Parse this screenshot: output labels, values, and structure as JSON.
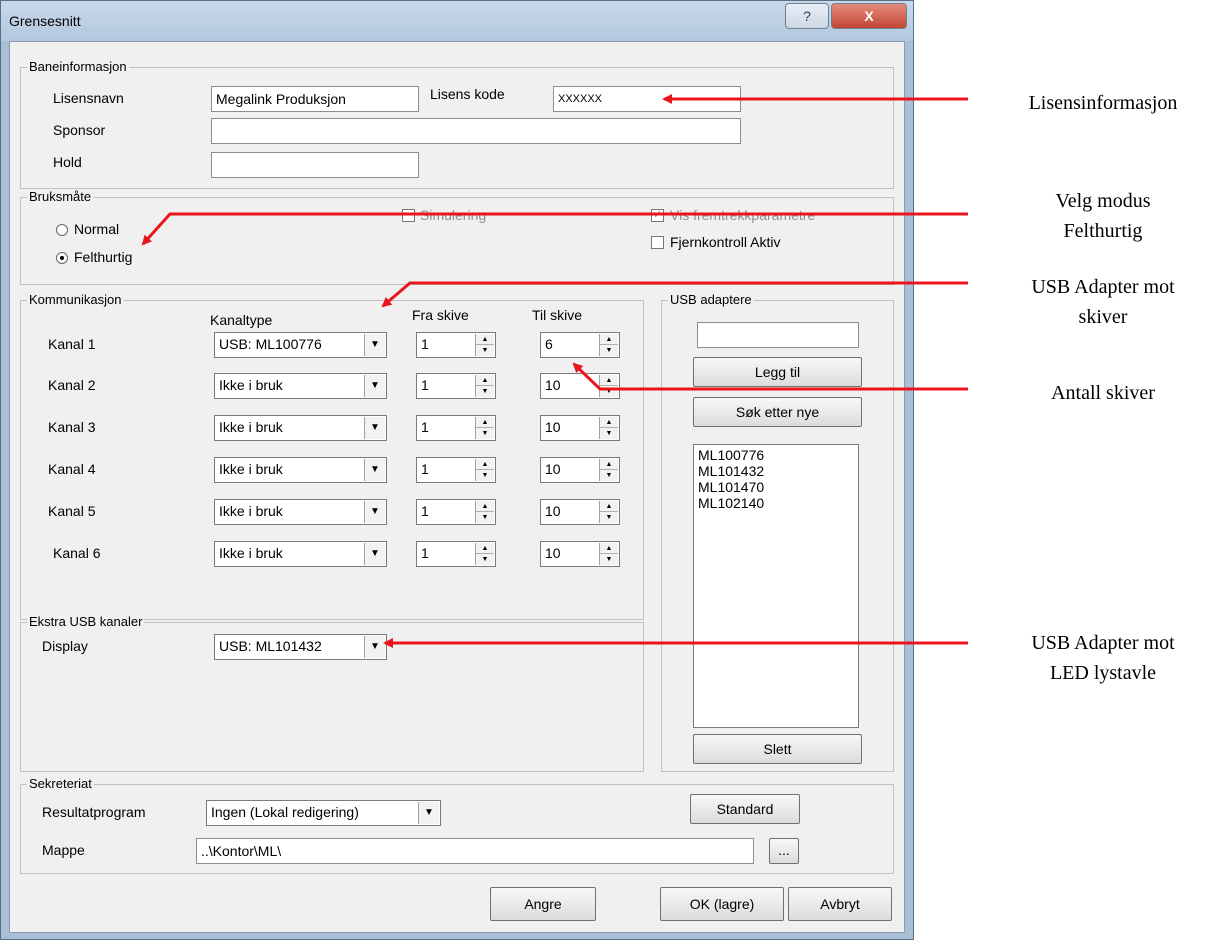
{
  "window": {
    "title": "Grensesnitt",
    "help": "?",
    "close": "X"
  },
  "bane": {
    "legend": "Baneinformasjon",
    "lisensnavn_label": "Lisensnavn",
    "lisensnavn_value": "Megalink Produksjon",
    "lisenskode_label": "Lisens kode",
    "lisenskode_value": "XXXXXX",
    "sponsor_label": "Sponsor",
    "sponsor_value": "",
    "hold_label": "Hold",
    "hold_value": ""
  },
  "bruk": {
    "legend": "Bruksmåte",
    "normal": "Normal",
    "felthurtig": "Felthurtig",
    "simulering": "Simulering",
    "vis": "Vis fremtrekkparametre",
    "fjern": "Fjernkontroll Aktiv"
  },
  "komm": {
    "legend": "Kommunikasjon",
    "h_kanaltype": "Kanaltype",
    "h_fra": "Fra skive",
    "h_til": "Til skive",
    "rows": [
      {
        "name": "Kanal 1",
        "type": "USB: ML100776",
        "fra": "1",
        "til": "6"
      },
      {
        "name": "Kanal 2",
        "type": "Ikke i bruk",
        "fra": "1",
        "til": "10"
      },
      {
        "name": "Kanal 3",
        "type": "Ikke i bruk",
        "fra": "1",
        "til": "10"
      },
      {
        "name": "Kanal 4",
        "type": "Ikke i bruk",
        "fra": "1",
        "til": "10"
      },
      {
        "name": "Kanal 5",
        "type": "Ikke i bruk",
        "fra": "1",
        "til": "10"
      },
      {
        "name": "Kanal 6",
        "type": "Ikke i bruk",
        "fra": "1",
        "til": "10"
      }
    ]
  },
  "usb": {
    "legend": "USB adaptere",
    "input_value": "",
    "legg_til": "Legg til",
    "sok": "Søk etter nye",
    "items": [
      "ML100776",
      "ML101432",
      "ML101470",
      "ML102140"
    ],
    "slett": "Slett"
  },
  "ekstra": {
    "legend": "Ekstra USB kanaler",
    "display_label": "Display",
    "display_value": "USB: ML101432"
  },
  "sekr": {
    "legend": "Sekreteriat",
    "resultat_label": "Resultatprogram",
    "resultat_value": "Ingen (Lokal redigering)",
    "standard": "Standard",
    "mappe_label": "Mappe",
    "mappe_value": "..\\Kontor\\ML\\",
    "browse": "..."
  },
  "footer": {
    "angre": "Angre",
    "ok": "OK (lagre)",
    "avbryt": "Avbryt"
  },
  "annotations": {
    "lisens": "Lisensinformasjon",
    "modus1": "Velg modus",
    "modus2": "Felthurtig",
    "usb1a": "USB Adapter mot",
    "usb1b": "skiver",
    "antall": "Antall skiver",
    "usb2a": "USB Adapter mot",
    "usb2b": "LED lystavle"
  },
  "colors": {
    "arrow": "#e8161b"
  }
}
